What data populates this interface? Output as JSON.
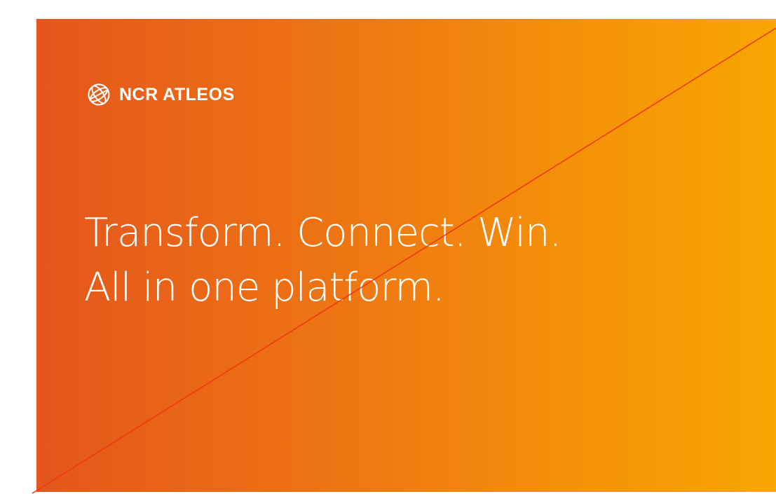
{
  "brand": {
    "name": "NCR ATLEOS",
    "icon": "globe-icon"
  },
  "headline": {
    "line1": "Transform. Connect. Win.",
    "line2": "All in one platform."
  },
  "colors": {
    "gradient_start": "#e4561c",
    "gradient_end": "#f8a602",
    "diagonal_line": "#f03a12",
    "text": "#ffffff"
  }
}
